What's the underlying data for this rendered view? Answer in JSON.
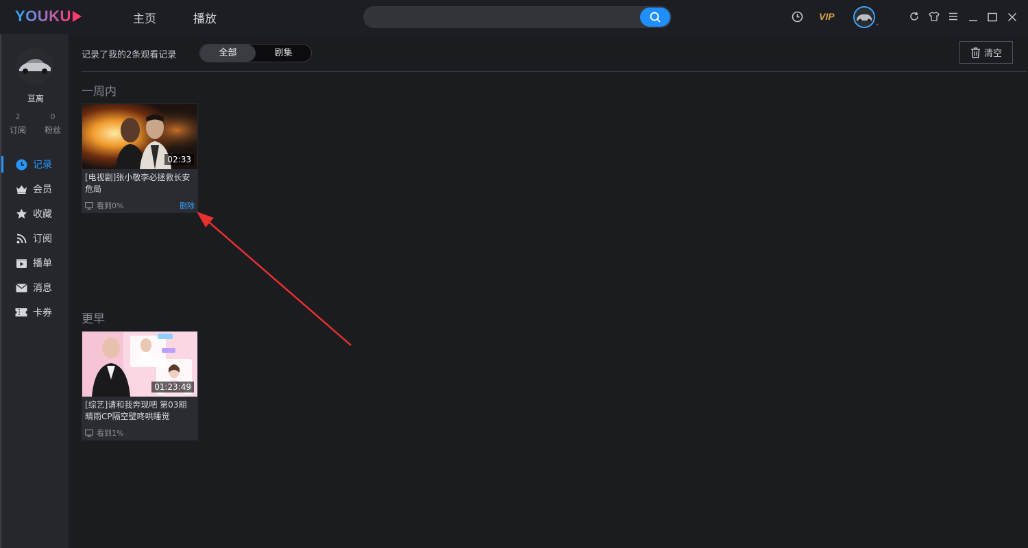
{
  "app": {
    "logo_text": "YOUKU"
  },
  "topbar": {
    "nav": [
      "主页",
      "播放"
    ],
    "search_placeholder": "",
    "vip_label": "VIP",
    "colors": {
      "accent": "#1f8fff",
      "vip": "#d4a045"
    },
    "icons": [
      "history-clock-icon",
      "vip-icon",
      "refresh-icon",
      "skin-shirt-icon",
      "menu-icon",
      "minimize-icon",
      "maximize-icon",
      "close-icon"
    ]
  },
  "profile": {
    "name": "亘离",
    "subscribe_count": "2",
    "subscribe_label": "订阅",
    "fans_count": "0",
    "fans_label": "粉丝"
  },
  "sidebar": {
    "items": [
      {
        "label": "记录",
        "icon": "clock-icon",
        "active": true
      },
      {
        "label": "会员",
        "icon": "crown-icon",
        "active": false
      },
      {
        "label": "收藏",
        "icon": "star-icon",
        "active": false
      },
      {
        "label": "订阅",
        "icon": "rss-icon",
        "active": false
      },
      {
        "label": "播单",
        "icon": "playlist-icon",
        "active": false
      },
      {
        "label": "消息",
        "icon": "mail-icon",
        "active": false
      },
      {
        "label": "卡券",
        "icon": "ticket-icon",
        "active": false
      }
    ]
  },
  "main": {
    "summary": "记录了我的2条观看记录",
    "filters": [
      {
        "label": "全部",
        "selected": true
      },
      {
        "label": "剧集",
        "selected": false
      }
    ],
    "clear_label": "清空",
    "sections": [
      {
        "title": "一周内",
        "items": [
          {
            "title": "[电视剧]张小敬李必拯救长安危局",
            "duration": "02:33",
            "progress": "看到0%",
            "delete_label": "删除"
          }
        ]
      },
      {
        "title": "更早",
        "items": [
          {
            "title": "[综艺]请和我奔现吧 第03期 晴雨CP隔空壁咚哄睡觉",
            "duration": "01:23:49",
            "progress": "看到1%"
          }
        ]
      }
    ]
  }
}
